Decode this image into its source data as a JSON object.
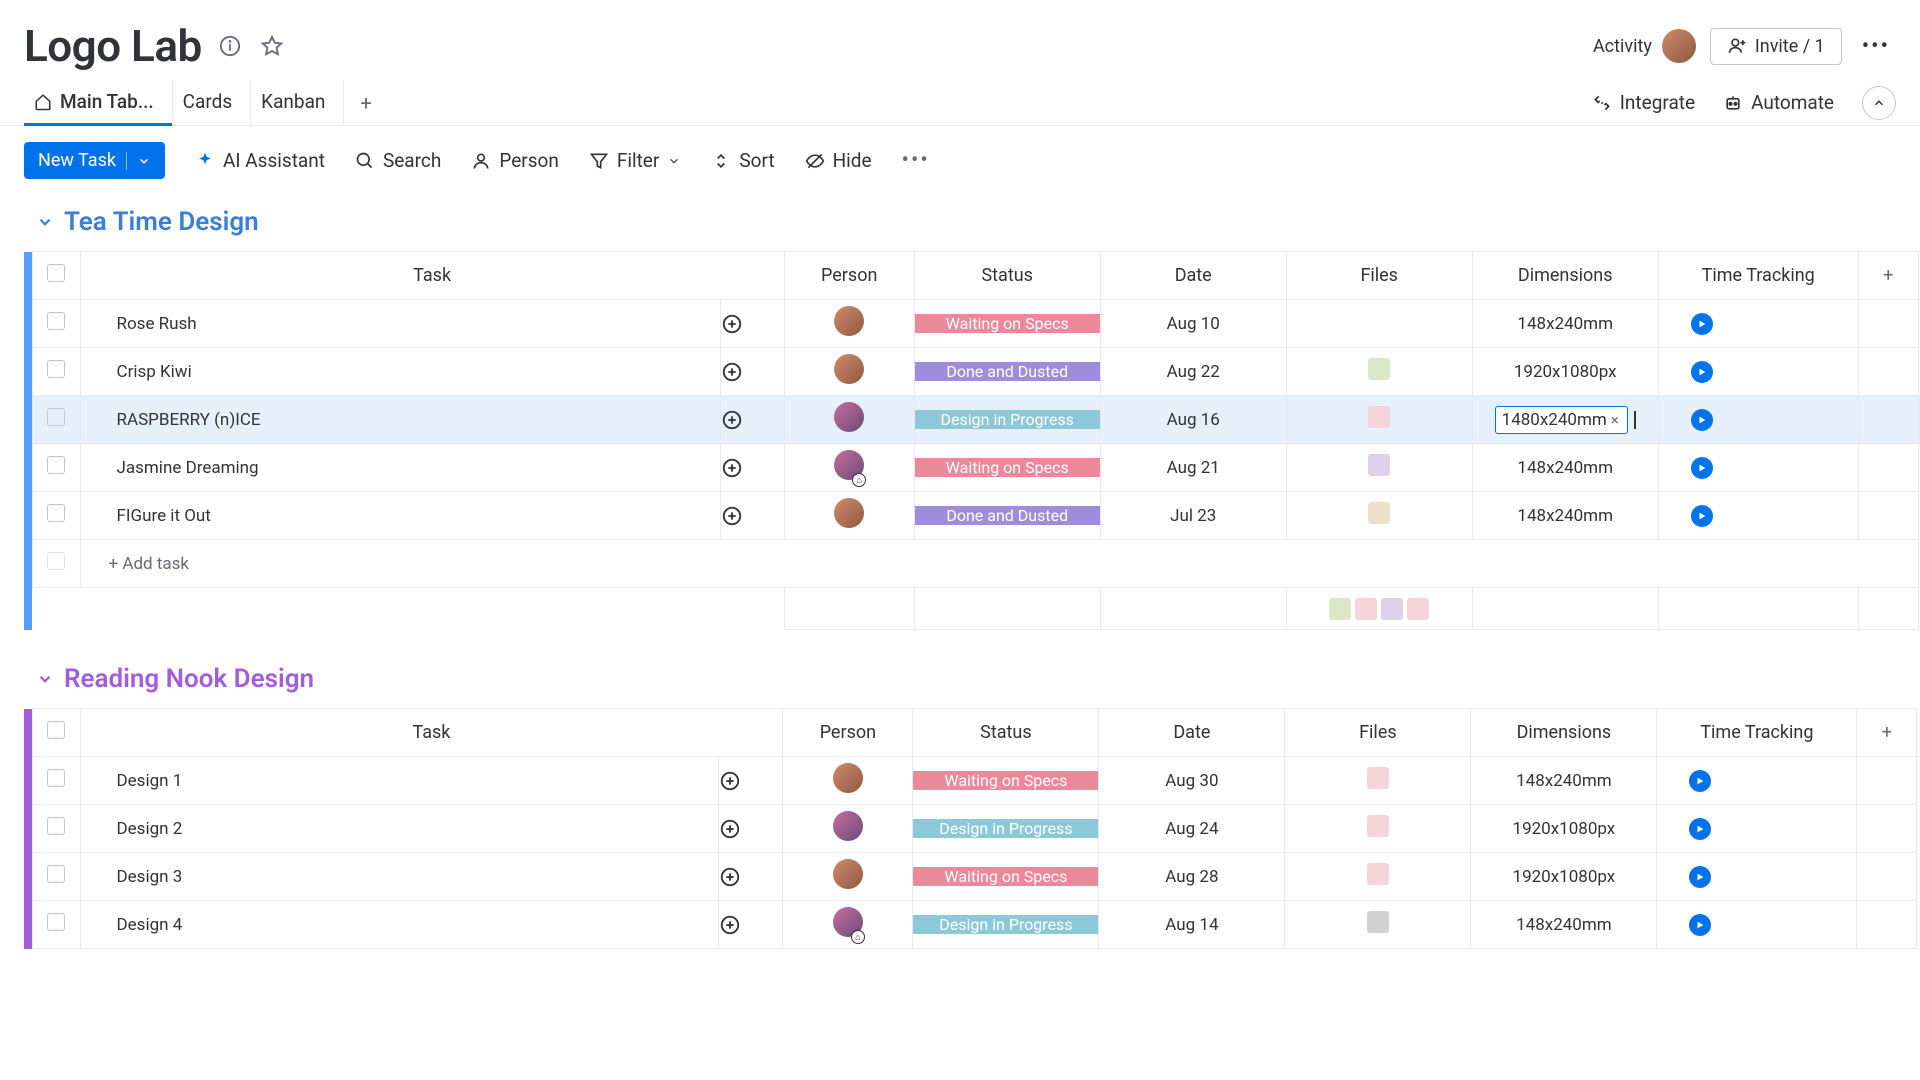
{
  "header": {
    "title": "Logo Lab",
    "activity_label": "Activity",
    "invite_label": "Invite / 1"
  },
  "tabs": {
    "items": [
      {
        "label": "Main Tab...",
        "active": true,
        "icon": "home"
      },
      {
        "label": "Cards",
        "active": false
      },
      {
        "label": "Kanban",
        "active": false
      }
    ],
    "integrate_label": "Integrate",
    "automate_label": "Automate"
  },
  "toolbar": {
    "new_task_label": "New Task",
    "ai_label": "AI Assistant",
    "search_label": "Search",
    "person_label": "Person",
    "filter_label": "Filter",
    "sort_label": "Sort",
    "hide_label": "Hide"
  },
  "columns": {
    "task": "Task",
    "person": "Person",
    "status": "Status",
    "date": "Date",
    "files": "Files",
    "dimensions": "Dimensions",
    "time": "Time Tracking"
  },
  "status_colors": {
    "Waiting on Specs": "#e9899a",
    "Done and Dusted": "#9d8ddb",
    "Design in Progress": "#8cc8d8"
  },
  "groups": [
    {
      "name": "Tea Time Design",
      "color_class": "group-blue",
      "rows": [
        {
          "task": "Rose Rush",
          "avatar": "a",
          "status": "Waiting on Specs",
          "date": "Aug 10",
          "file": "",
          "dimensions": "148x240mm",
          "editing": false,
          "highlight": false
        },
        {
          "task": "Crisp Kiwi",
          "avatar": "a",
          "status": "Done and Dusted",
          "date": "Aug 22",
          "file": "green",
          "dimensions": "1920x1080px",
          "editing": false,
          "highlight": false
        },
        {
          "task": "RASPBERRY (n)ICE",
          "avatar": "b",
          "status": "Design in Progress",
          "date": "Aug 16",
          "file": "pink",
          "dimensions": "1480x240mm",
          "editing": true,
          "highlight": true
        },
        {
          "task": "Jasmine Dreaming",
          "avatar": "b",
          "status": "Waiting on Specs",
          "date": "Aug 21",
          "file": "lav",
          "dimensions": "148x240mm",
          "editing": false,
          "highlight": false,
          "badge": true
        },
        {
          "task": "FIGure it Out",
          "avatar": "a",
          "status": "Done and Dusted",
          "date": "Jul 23",
          "file": "cream",
          "dimensions": "148x240mm",
          "editing": false,
          "highlight": false
        }
      ],
      "add_task_label": "+ Add task"
    },
    {
      "name": "Reading Nook Design",
      "color_class": "group-purple",
      "rows": [
        {
          "task": "Design 1",
          "avatar": "a",
          "status": "Waiting on Specs",
          "date": "Aug 30",
          "file": "pink",
          "dimensions": "148x240mm",
          "editing": false,
          "highlight": false
        },
        {
          "task": "Design 2",
          "avatar": "b",
          "status": "Design in Progress",
          "date": "Aug 24",
          "file": "pink",
          "dimensions": "1920x1080px",
          "editing": false,
          "highlight": false
        },
        {
          "task": "Design 3",
          "avatar": "a",
          "status": "Waiting on Specs",
          "date": "Aug 28",
          "file": "pink",
          "dimensions": "1920x1080px",
          "editing": false,
          "highlight": false
        },
        {
          "task": "Design 4",
          "avatar": "b",
          "status": "Design in Progress",
          "date": "Aug 14",
          "file": "grey",
          "dimensions": "148x240mm",
          "editing": false,
          "highlight": false,
          "badge": true
        }
      ]
    }
  ]
}
